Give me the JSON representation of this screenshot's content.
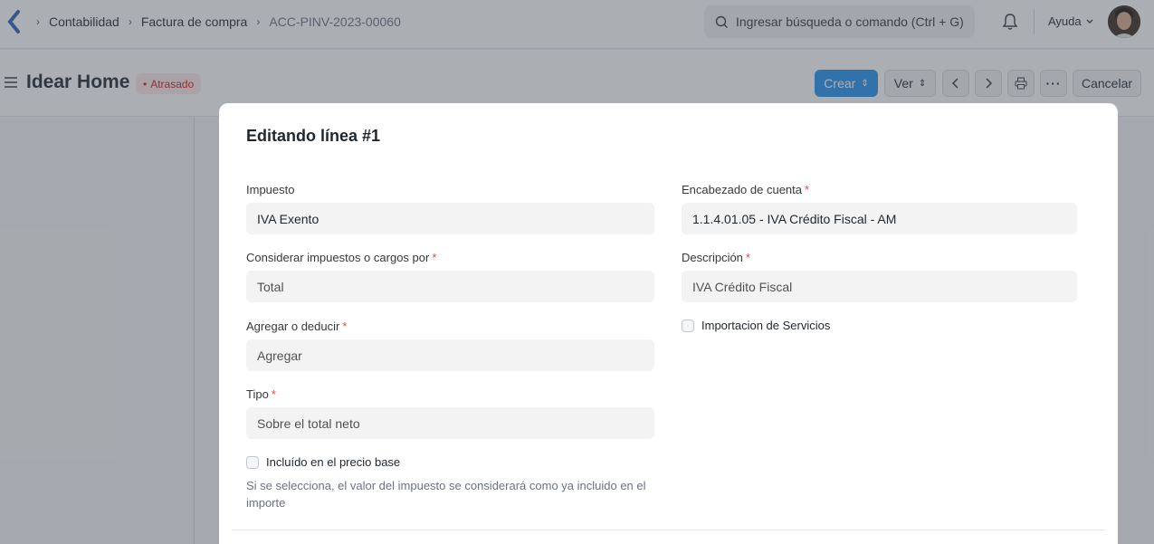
{
  "navbar": {
    "breadcrumbs": [
      "Contabilidad",
      "Factura de compra",
      "ACC-PINV-2023-00060"
    ],
    "search_placeholder": "Ingresar búsqueda o comando (Ctrl + G)",
    "help_label": "Ayuda"
  },
  "page": {
    "title": "Idear Home",
    "status": "Atrasado",
    "status_color": "#c81e1e",
    "buttons": {
      "create": "Crear",
      "view": "Ver",
      "cancel": "Cancelar"
    },
    "accent_color": "#2490ef"
  },
  "modal": {
    "title": "Editando línea #1",
    "left": {
      "impuesto": {
        "label": "Impuesto",
        "value": "IVA Exento"
      },
      "considerar": {
        "label": "Considerar impuestos o cargos por",
        "value": "Total"
      },
      "agregar": {
        "label": "Agregar o deducir",
        "value": "Agregar"
      },
      "tipo": {
        "label": "Tipo",
        "value": "Sobre el total neto"
      },
      "incluido": {
        "label": "Incluído en el precio base",
        "checked": false
      },
      "help": "Si se selecciona, el valor del impuesto se considerará como ya incluido en el importe"
    },
    "right": {
      "encabezado": {
        "label": "Encabezado de cuenta",
        "value": "1.1.4.01.05 - IVA Crédito Fiscal - AM"
      },
      "descripcion": {
        "label": "Descripción",
        "value": "IVA Crédito Fiscal"
      },
      "importacion": {
        "label": "Importacion de Servicios",
        "checked": false
      }
    },
    "required_mark": "*"
  }
}
